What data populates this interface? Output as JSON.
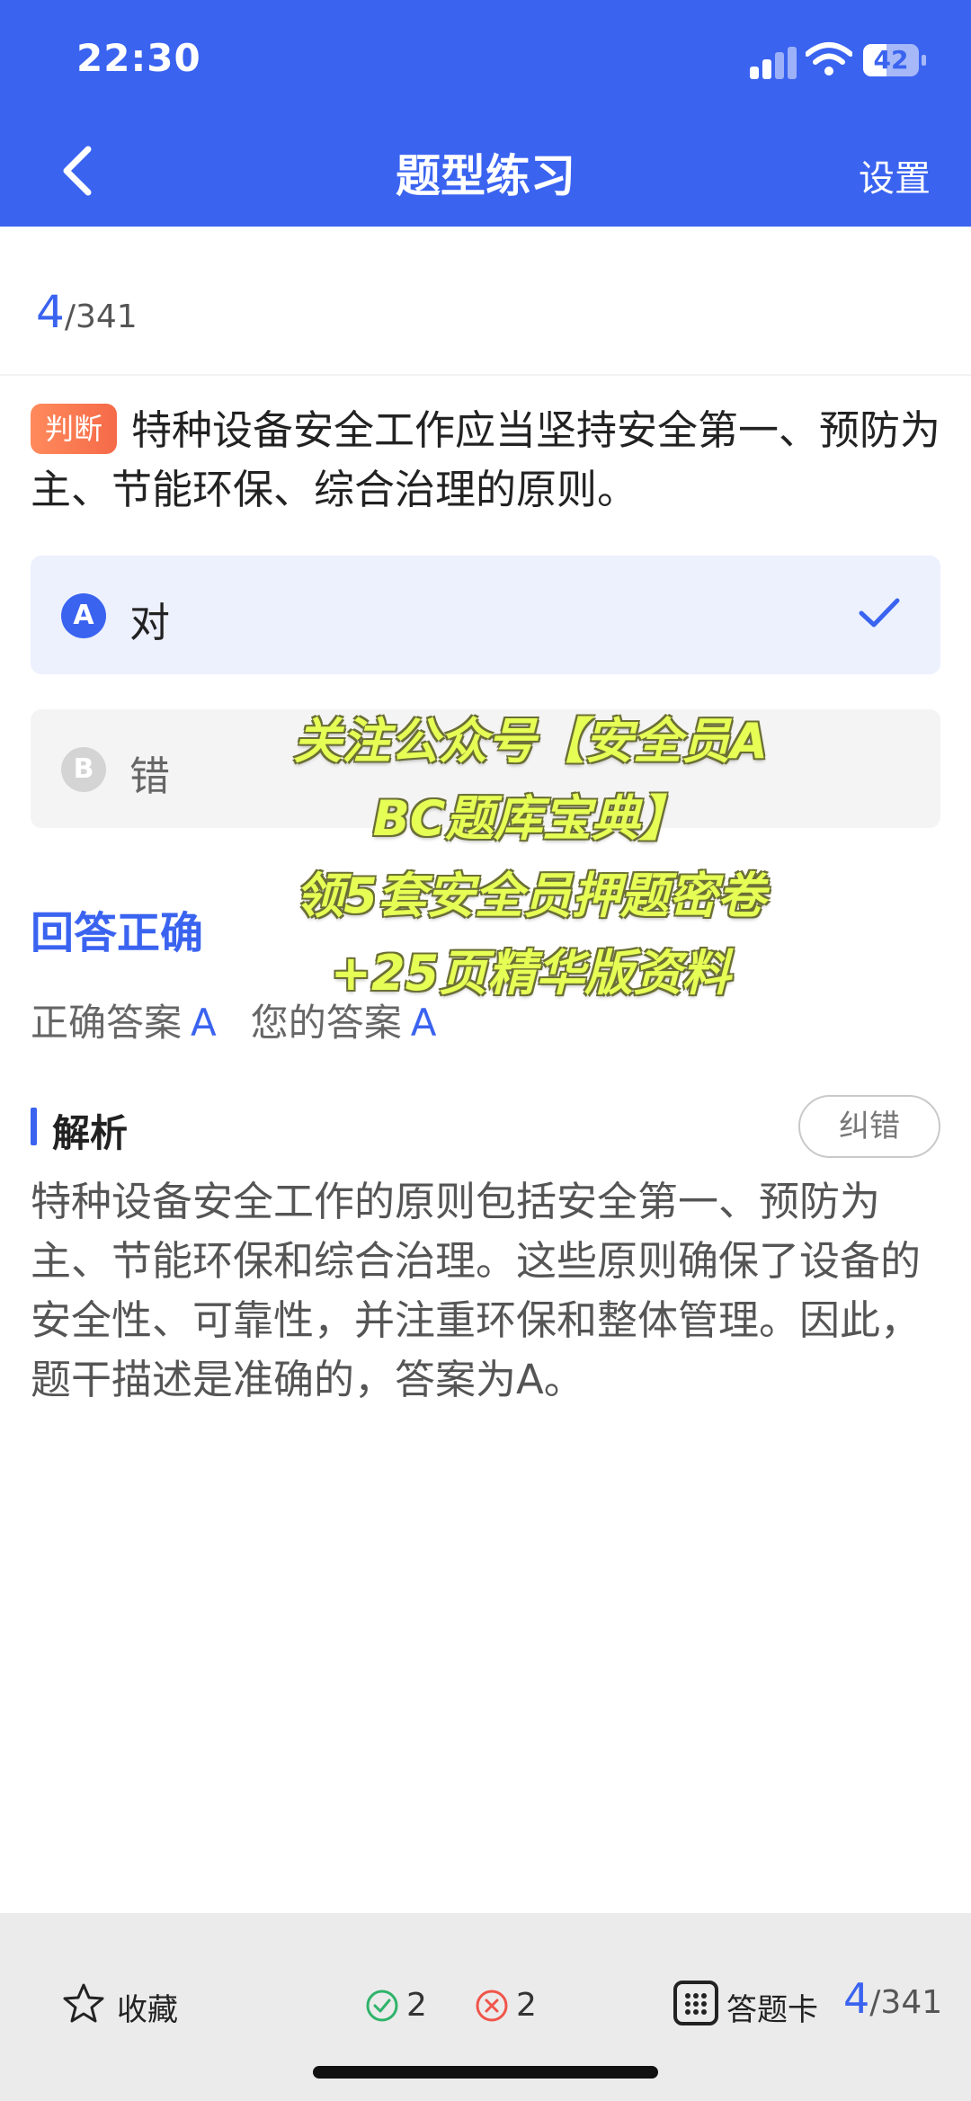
{
  "status_bar": {
    "time": "22:30",
    "battery": "42",
    "battery_level": 0.42
  },
  "nav": {
    "title": "题型练习",
    "settings_label": "设置"
  },
  "progress": {
    "current": "4",
    "total": "/341"
  },
  "question": {
    "type_tag": "判断",
    "text": "特种设备安全工作应当坚持安全第一、预防为主、节能环保、综合治理的原则。"
  },
  "options": [
    {
      "letter": "A",
      "text": "对",
      "selected": true
    },
    {
      "letter": "B",
      "text": "错",
      "selected": false
    }
  ],
  "overlay": {
    "lines": [
      "关注公众号【安全员A",
      "BC题库宝典】",
      "领5套安全员押题密卷",
      "+25页精华版资料"
    ]
  },
  "result": {
    "status": "回答正确",
    "correct_label": "正确答案",
    "correct_value": "A",
    "yours_label": "您的答案",
    "yours_value": "A"
  },
  "analysis": {
    "title": "解析",
    "report_label": "纠错",
    "text": "特种设备安全工作的原则包括安全第一、预防为主、节能环保和综合治理。这些原则确保了设备的安全性、可靠性，并注重环保和整体管理。因此，题干描述是准确的，答案为A。"
  },
  "bottom_bar": {
    "favorite_label": "收藏",
    "correct_count": "2",
    "wrong_count": "2",
    "answer_card_label": "答题卡",
    "current": "4",
    "total": "/341"
  },
  "colors": {
    "accent": "#3a63f0",
    "tag": "#f56a48",
    "correct": "#2fb36a",
    "wrong": "#f0554a",
    "overlay_text": "#e6ff55"
  }
}
